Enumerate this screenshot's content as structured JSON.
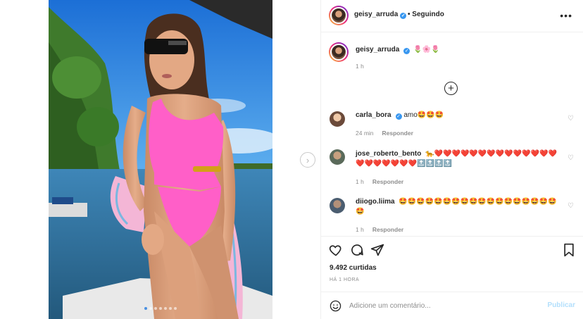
{
  "post": {
    "author": "geisy_arruda",
    "follow_status": "Seguindo",
    "more_icon": "more-horizontal-icon",
    "caption": {
      "username": "geisy_arruda",
      "emojis": "🌷🌸🌷",
      "time": "1 h"
    },
    "load_more_icon": "plus-circle-icon",
    "likes": "9.492 curtidas",
    "timestamp": "HÁ 1 HORA"
  },
  "comments": [
    {
      "username": "carla_bora",
      "verified": true,
      "text": "amo🤩🤩🤩",
      "time": "24 min",
      "reply": "Responder"
    },
    {
      "username": "jose_roberto_bento",
      "verified": false,
      "text": "🐆❤️❤️❤️❤️❤️❤️❤️❤️❤️❤️❤️❤️❤️❤️❤️❤️❤️❤️❤️❤️❤️🔝🔝🔝🔝",
      "time": "1 h",
      "reply": "Responder"
    },
    {
      "username": "diiogo.liima",
      "verified": false,
      "text": "🤩🤩🤩🤩🤩🤩🤩🤩🤩🤩🤩🤩🤩🤩🤩🤩🤩🤩🤩",
      "time": "1 h",
      "reply": "Responder"
    }
  ],
  "composer": {
    "placeholder": "Adicione um comentário...",
    "publish_label": "Publicar"
  },
  "colors": {
    "verified": "#3897f0",
    "publish_disabled": "#b2dffc",
    "muted_text": "#8e8e8e"
  }
}
